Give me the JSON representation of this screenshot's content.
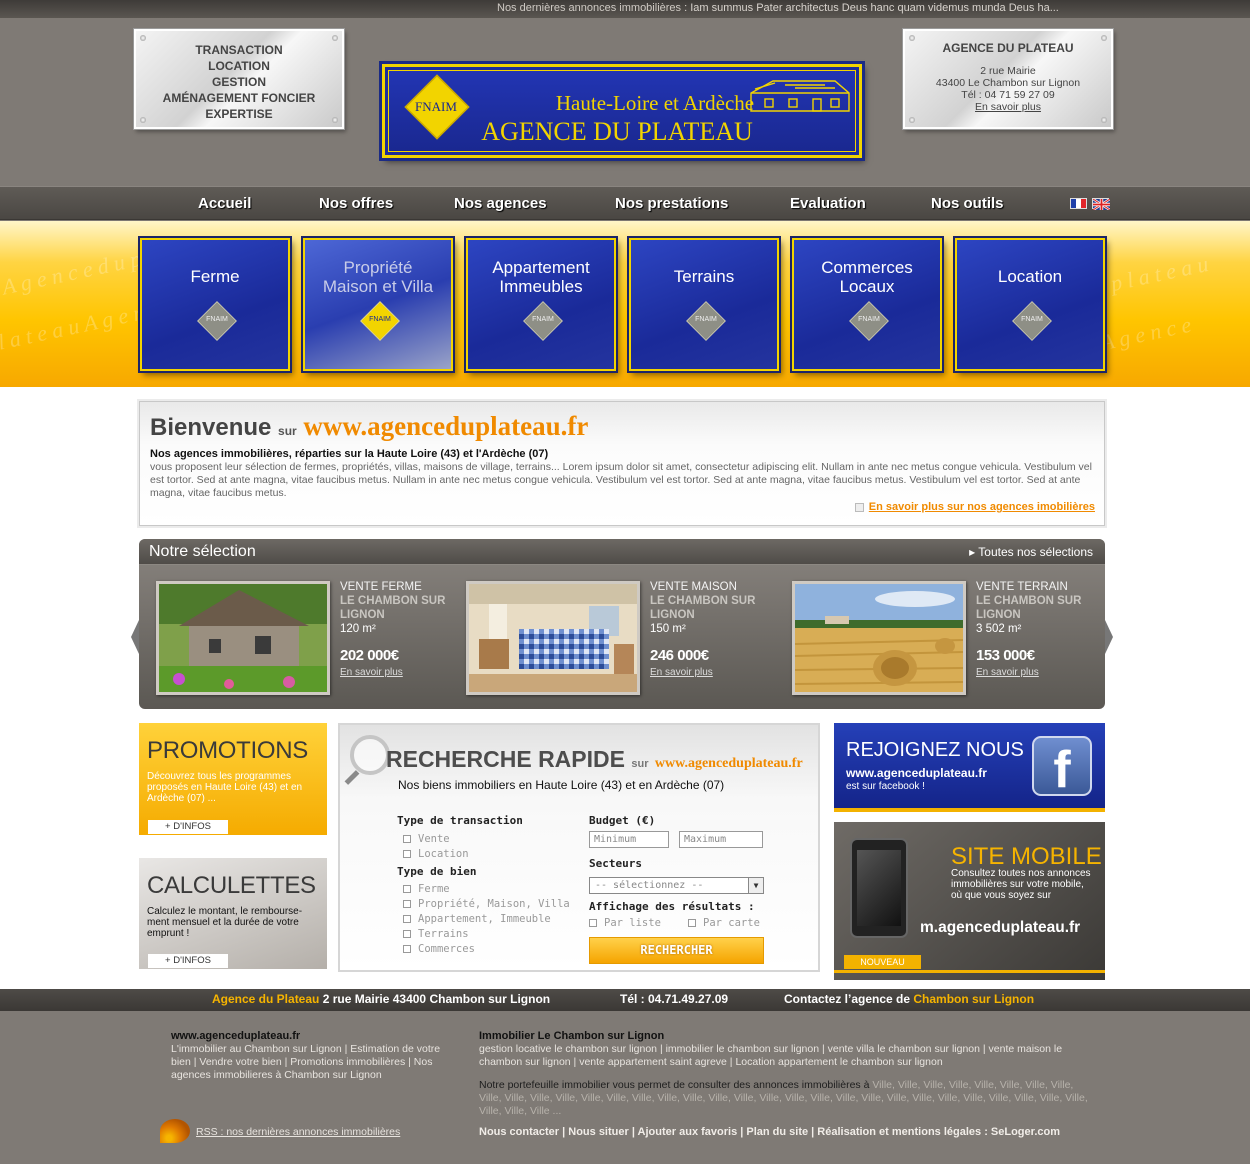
{
  "ticker": {
    "label": "Nos dernières annonces immobilières",
    "text": " : Iam summus Pater architectus Deus hanc quam videmus munda Deus ha..."
  },
  "plaque_left": {
    "lines": [
      "TRANSACTION",
      "LOCATION",
      "GESTION",
      "AMÉNAGEMENT FONCIER",
      "EXPERTISE"
    ]
  },
  "plaque_right": {
    "title": "AGENCE DU PLATEAU",
    "address1": "2 rue Mairie",
    "address2": "43400 Le Chambon sur Lignon",
    "phone": "Tél : 04 71 59 27 09",
    "more": "En savoir plus"
  },
  "logo": {
    "badge": "FNAIM",
    "line1": "Haute-Loire et Ardèche",
    "line2": "AGENCE DU PLATEAU"
  },
  "nav": {
    "items": [
      "Accueil",
      "Nos offres",
      "Nos agences",
      "Nos prestations",
      "Evaluation",
      "Nos outils"
    ]
  },
  "categories": [
    {
      "line1": "Ferme",
      "line2": "",
      "badge": "FNAIM"
    },
    {
      "line1": "Propriété",
      "line2": "Maison et Villa",
      "badge": "FNAIM"
    },
    {
      "line1": "Appartement",
      "line2": "Immeubles",
      "badge": "FNAIM"
    },
    {
      "line1": "Terrains",
      "line2": "",
      "badge": "FNAIM"
    },
    {
      "line1": "Commerces",
      "line2": "Locaux",
      "badge": "FNAIM"
    },
    {
      "line1": "Location",
      "line2": "",
      "badge": "FNAIM"
    }
  ],
  "welcome": {
    "title": "Bienvenue",
    "sur": "sur",
    "url": "www.agenceduplateau.fr",
    "subtitle": "Nos agences immobilières, réparties sur la Haute Loire (43) et l'Ardèche (07)",
    "body": "vous proposent leur sélection de fermes, propriétés, villas, maisons de village, terrains... Lorem ipsum dolor sit amet, consectetur adipiscing elit. Nullam in ante nec metus congue vehicula. Vestibulum vel est tortor. Sed at ante magna, vitae faucibus metus. Nullam in ante nec metus congue vehicula. Vestibulum vel est tortor. Sed at ante magna, vitae faucibus metus. Vestibulum vel est tortor. Sed at ante magna, vitae faucibus metus.",
    "more": "En savoir plus sur nos agences imobilières"
  },
  "selection": {
    "title": "Notre sélection",
    "all": "Toutes nos sélections",
    "items": [
      {
        "type": "VENTE FERME",
        "loc1": "LE CHAMBON SUR",
        "loc2": "LIGNON",
        "area": "120 m²",
        "price": "202 000€",
        "more": "En savoir plus"
      },
      {
        "type": "VENTE MAISON",
        "loc1": "LE CHAMBON SUR",
        "loc2": "LIGNON",
        "area": "150 m²",
        "price": "246 000€",
        "more": "En savoir plus"
      },
      {
        "type": "VENTE TERRAIN",
        "loc1": "LE CHAMBON SUR",
        "loc2": "LIGNON",
        "area": "3 502 m²",
        "price": "153 000€",
        "more": "En savoir plus"
      }
    ]
  },
  "promotions": {
    "title": "PROMOTIONS",
    "body": "Découvrez tous les programmes proposés en Haute Loire (43) et en Ardèche (07) ...",
    "button": "+ D'INFOS"
  },
  "calculettes": {
    "title": "CALCULETTES",
    "body": "Calculez le montant, le rembourse-ment mensuel et la durée de votre emprunt !",
    "button": "+ D'INFOS"
  },
  "search": {
    "title": "RECHERCHE RAPIDE",
    "sur": "sur",
    "url": "www.agenceduplateau.fr",
    "subtitle": "Nos biens immobiliers en Haute Loire (43) et en Ardèche (07)",
    "transaction_label": "Type de transaction",
    "transaction_options": [
      "Vente",
      "Location"
    ],
    "bien_label": "Type de bien",
    "bien_options": [
      "Ferme",
      "Propriété, Maison, Villa",
      "Appartement, Immeuble",
      "Terrains",
      "Commerces"
    ],
    "budget_label": "Budget (€)",
    "min_placeholder": "Minimum",
    "max_placeholder": "Maximum",
    "secteurs_label": "Secteurs",
    "secteurs_value": "-- sélectionnez --",
    "affichage_label": "Affichage des résultats :",
    "affichage_options": [
      "Par liste",
      "Par carte"
    ],
    "button": "RECHERCHER"
  },
  "facebook": {
    "title": "REJOIGNEZ NOUS",
    "url": "www.agenceduplateau.fr",
    "sub": "est sur facebook !",
    "logo": "f"
  },
  "mobile": {
    "title": "SITE MOBILE",
    "body": "Consultez toutes nos annonces immobilières sur votre mobile, où que vous soyez sur",
    "url": "m.agenceduplateau.fr",
    "badge": "NOUVEAU"
  },
  "footer_bar": {
    "agency": "Agence du Plateau",
    "address": " 2 rue Mairie 43400 Chambon sur Lignon",
    "phone": "Tél : 04.71.49.27.09",
    "contact": "Contactez l’agence de ",
    "town": "Chambon sur Lignon"
  },
  "footer": {
    "left_title": "www.agenceduplateau.fr",
    "left_links": "L'immobilier au Chambon sur Lignon  | Estimation de votre bien | Vendre votre bien | Promotions immobilières  |  Nos agences immobilieres à Chambon sur Lignon",
    "right_title": "Immobilier Le Chambon sur Lignon",
    "right_links": "gestion locative le chambon sur lignon | immobilier le chambon sur lignon  |  vente villa le chambon sur lignon | vente maison le chambon sur lignon  |  vente appartement saint agreve | Location appartement le chambon sur lignon",
    "portfolio_text": "Notre portefeuille immobilier vous permet de consulter des annonces immobilières à ",
    "villes": "Ville, Ville, Ville, Ville, Ville, Ville, Ville, Ville, Ville, Ville, Ville, Ville, Ville, Ville, Ville, Ville, Ville, Ville, Ville, Ville, Ville, Ville, Ville, Ville, Ville, Ville, Ville, Ville, Ville, Ville, Ville, Ville, Ville, Ville, Ville ...",
    "rss": "RSS : nos dernières annonces immobilières",
    "menu": "Nous contacter | Nous situer  |  Ajouter aux favoris  | Plan du site  |  Réalisation et mentions légales : SeLoger.com"
  }
}
